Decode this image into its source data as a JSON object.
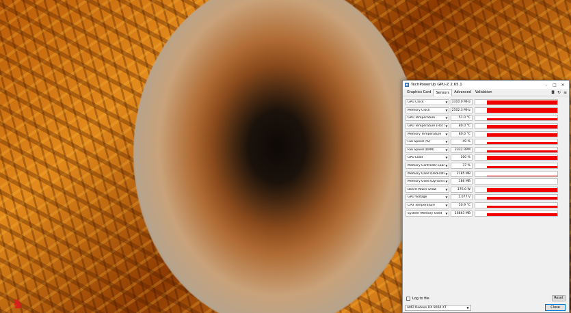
{
  "window": {
    "title": "TechPowerUp GPU-Z 2.65.1",
    "app_icon": "gpu-z-icon",
    "controls": [
      "minimize-icon",
      "maximize-icon",
      "close-icon"
    ]
  },
  "tabs": [
    {
      "label": "Graphics Card"
    },
    {
      "label": "Sensors"
    },
    {
      "label": "Advanced"
    },
    {
      "label": "Validation"
    }
  ],
  "active_tab": "Sensors",
  "tools": [
    "camera-icon",
    "refresh-icon",
    "menu-icon"
  ],
  "sensors": [
    {
      "name": "GPU Clock",
      "value": "3310.0 MHz",
      "level": 0.95
    },
    {
      "name": "Memory Clock",
      "value": "2502.3 MHz",
      "level": 0.95
    },
    {
      "name": "GPU Temperature",
      "value": "51.0 °C",
      "level": 0.55
    },
    {
      "name": "GPU Temperature (Hot Spot)",
      "value": "80.0 °C",
      "level": 0.7
    },
    {
      "name": "Memory Temperature",
      "value": "80.0 °C",
      "level": 0.72
    },
    {
      "name": "Fan Speed (%)",
      "value": "49 %",
      "level": 0.5
    },
    {
      "name": "Fan Speed (RPM)",
      "value": "2332 RPM",
      "level": 0.45
    },
    {
      "name": "GPU Load",
      "value": "100 %",
      "level": 0.98
    },
    {
      "name": "Memory Controller Load",
      "value": "37 %",
      "level": 0.38
    },
    {
      "name": "Memory Used (Dedicated)",
      "value": "2185 MB",
      "level": 0.15
    },
    {
      "name": "Memory Used (Dynamic)",
      "value": "186 MB",
      "level": 0.05
    },
    {
      "name": "Board Power Draw",
      "value": "176.0 W",
      "level": 0.85
    },
    {
      "name": "GPU Voltage",
      "value": "1.077 V",
      "level": 0.6
    },
    {
      "name": "CPU Temperature",
      "value": "50.9 °C",
      "level": 0.5
    },
    {
      "name": "System Memory Used",
      "value": "16863 MB",
      "level": 0.55
    }
  ],
  "footer": {
    "log_label": "Log to file",
    "reset_label": "Reset",
    "gpu_name": "AMD Radeon RX 9060 XT",
    "close_label": "Close"
  },
  "colors": {
    "graph_fill": "#f20000",
    "accent": "#0078d4"
  }
}
